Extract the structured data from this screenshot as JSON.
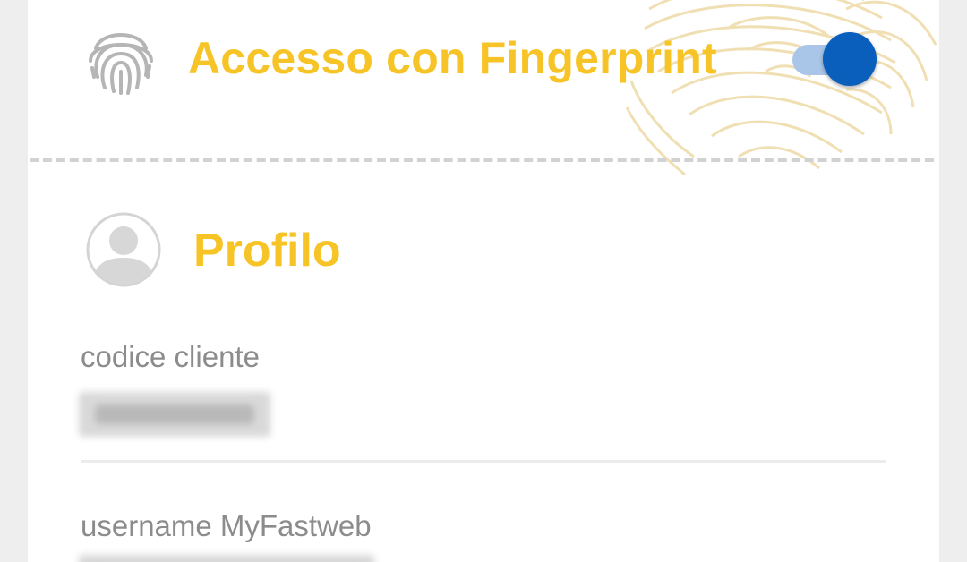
{
  "fingerprint": {
    "title": "Accesso con Fingerprint",
    "icon": "fingerprint-icon",
    "toggle_state": "on",
    "accent_color": "#f7c427",
    "toggle_color": "#0a5fbd"
  },
  "profile": {
    "title": "Profilo",
    "icon": "avatar-icon",
    "fields": [
      {
        "label": "codice cliente",
        "value_state": "blurred"
      },
      {
        "label": "username MyFastweb",
        "value_state": "blurred"
      }
    ]
  }
}
